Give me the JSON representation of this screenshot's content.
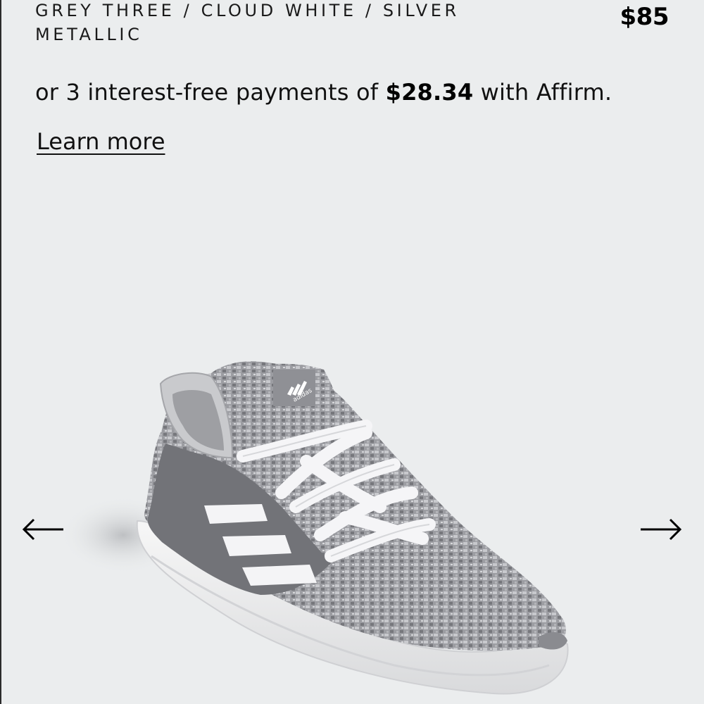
{
  "product": {
    "color_name": "GREY THREE / CLOUD WHITE / SILVER METALLIC",
    "price": "$85",
    "brand_tag": "adidas"
  },
  "affirm": {
    "prefix": "or 3 interest-free payments of ",
    "amount": "$28.34",
    "suffix": " with Affirm.",
    "learn_more": "Learn more"
  },
  "carousel": {
    "prev_icon": "arrow-left-icon",
    "next_icon": "arrow-right-icon"
  },
  "colors": {
    "background": "#ebedee",
    "text": "#111111",
    "shoe_grey": "#8a8b90",
    "shoe_sole": "#f2f2f2"
  }
}
